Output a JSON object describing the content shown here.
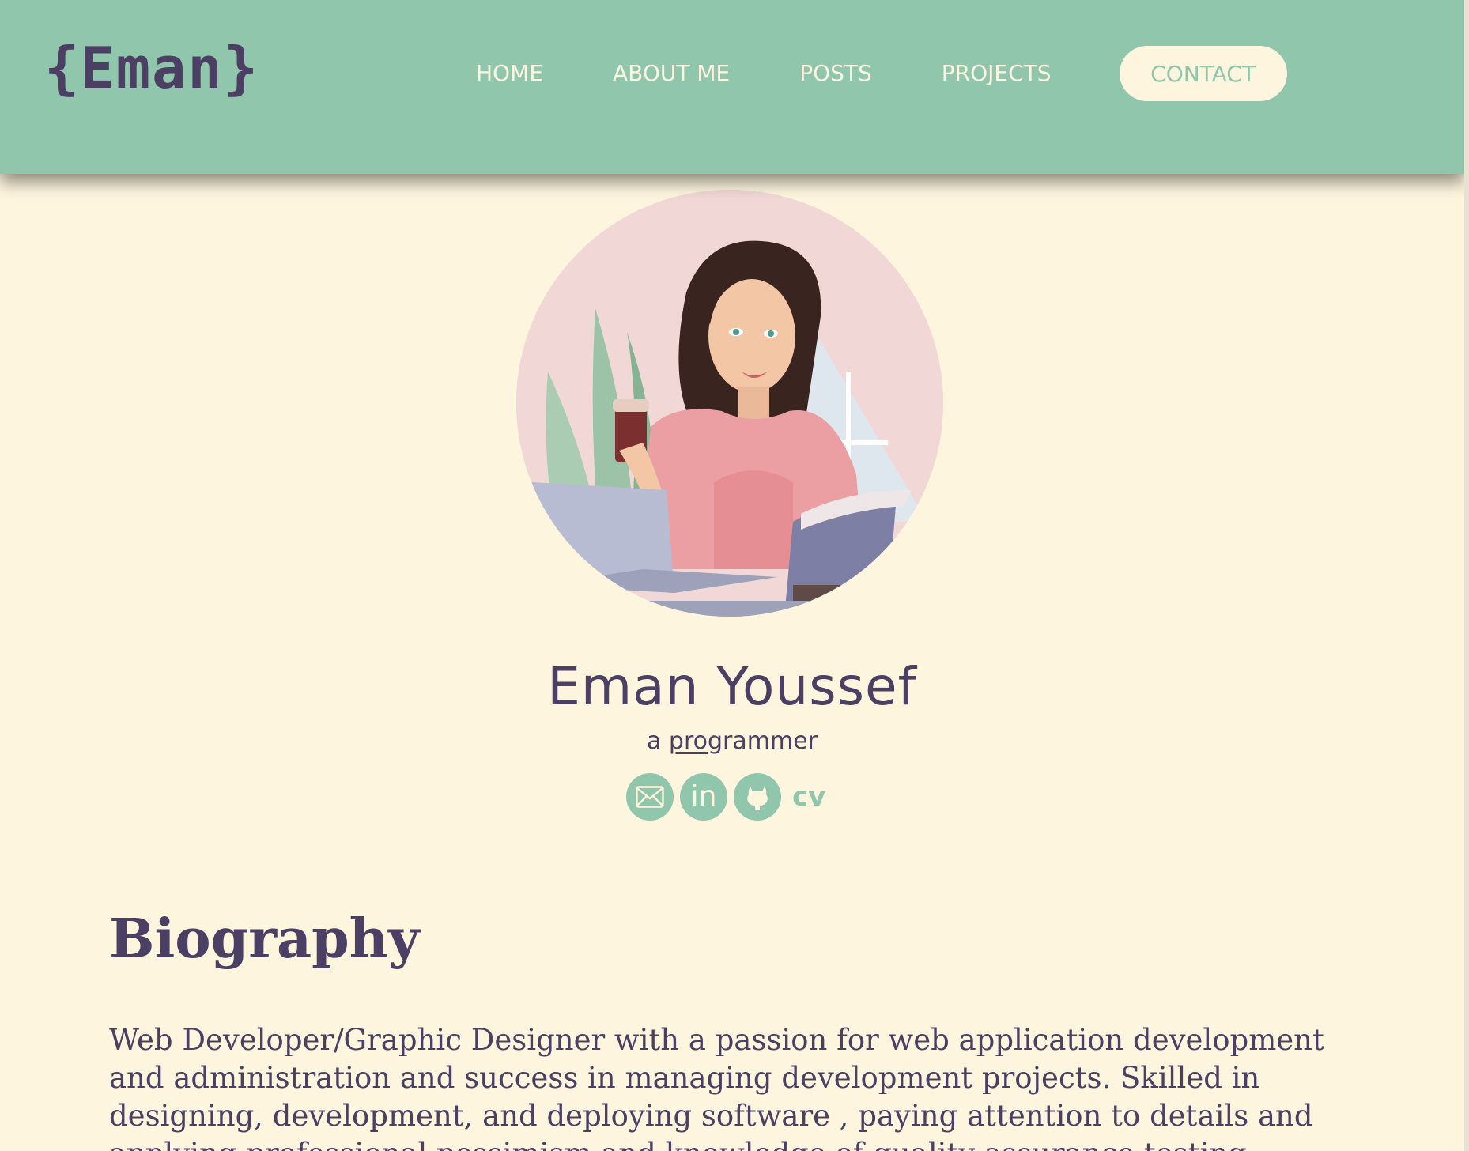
{
  "header": {
    "logo": "{Eman}",
    "nav": {
      "home": "HOME",
      "about": "ABOUT ME",
      "posts": "POSTS",
      "projects": "PROJECTS",
      "contact": "CONTACT"
    }
  },
  "profile": {
    "name": "Eman Youssef",
    "tagline_prefix": "a ",
    "tagline_highlight": "pro",
    "tagline_rest": "grammer",
    "socials": [
      {
        "icon": "mail-icon"
      },
      {
        "icon": "linkedin-icon",
        "text": "in"
      },
      {
        "icon": "github-icon"
      }
    ],
    "cv_label": "cv"
  },
  "biography": {
    "title": "Biography",
    "text": "Web Developer/Graphic Designer with a passion for web application development and administration and success in managing development projects. Skilled in designing, development, and deploying software , paying attention to details and applying professional pessimism and knowledge of quality assurance testing."
  },
  "colors": {
    "header_bg": "#8fc6ac",
    "page_bg": "#fdf5dd",
    "text_primary": "#4b3f63",
    "accent": "#8fc6ac"
  }
}
